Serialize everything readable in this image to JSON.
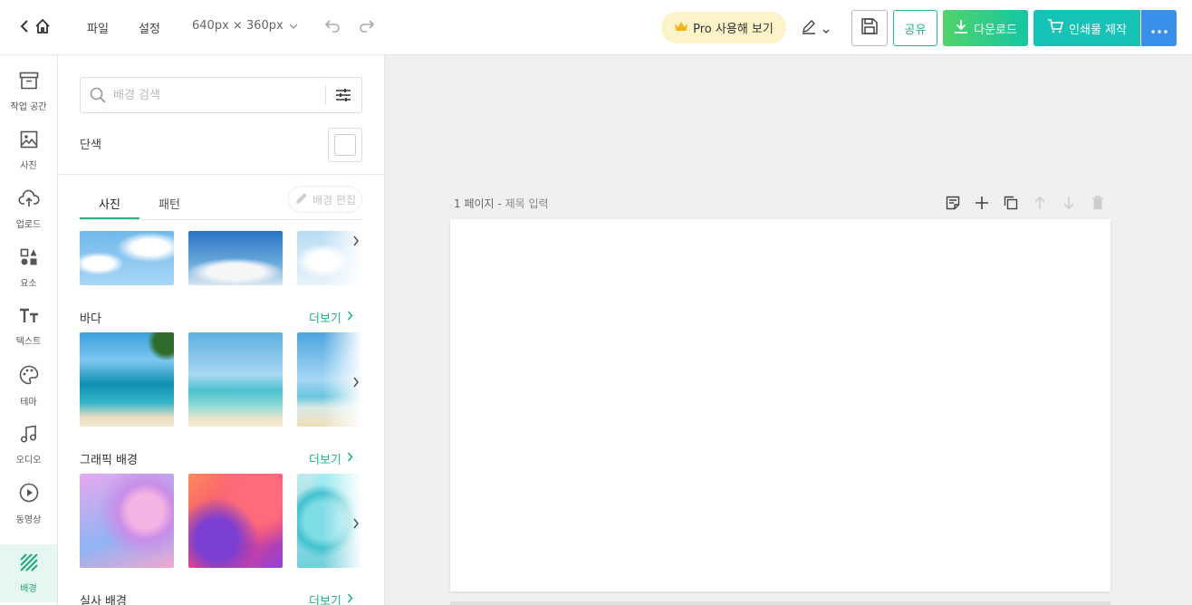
{
  "topbar": {
    "file_label": "파일",
    "settings_label": "설정",
    "canvas_size": "640px × 360px",
    "pro_label": "Pro 사용해 보기",
    "share_label": "공유",
    "download_label": "다운로드",
    "print_label": "인쇄물 제작"
  },
  "rail": {
    "items": [
      {
        "label": "작업 공간",
        "icon": "archive-icon"
      },
      {
        "label": "사진",
        "icon": "image-icon"
      },
      {
        "label": "업로드",
        "icon": "upload-cloud-icon"
      },
      {
        "label": "요소",
        "icon": "shapes-icon"
      },
      {
        "label": "텍스트",
        "icon": "text-icon"
      },
      {
        "label": "테마",
        "icon": "palette-icon"
      },
      {
        "label": "오디오",
        "icon": "music-icon"
      },
      {
        "label": "동영상",
        "icon": "play-icon"
      },
      {
        "label": "배경",
        "icon": "stripes-icon",
        "active": true
      }
    ]
  },
  "panel": {
    "search_placeholder": "배경 검색",
    "solid_label": "단색",
    "tabs": [
      "사진",
      "패턴"
    ],
    "edit_bg_label": "배경 편집",
    "sections": [
      {
        "title": "바다",
        "more": "더보기"
      },
      {
        "title": "그래픽 배경",
        "more": "더보기"
      },
      {
        "title": "실사 배경",
        "more": "더보기"
      }
    ]
  },
  "canvas": {
    "page_number": "1 페이지",
    "separator": "-",
    "title_placeholder": "제목 입력"
  },
  "colors": {
    "accent": "#1fb48a",
    "print": "#17c2b6",
    "more": "#3a8fe8",
    "pro_bg": "#fdf3c8"
  }
}
